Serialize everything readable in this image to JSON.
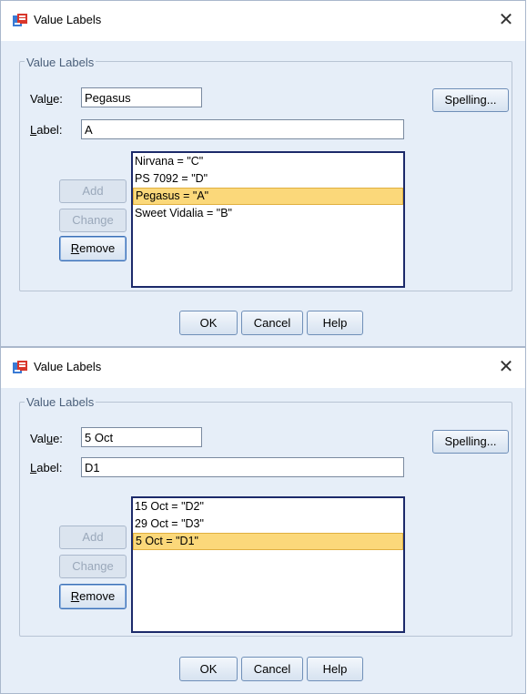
{
  "dialogs": [
    {
      "title": "Value Labels",
      "group_label": "Value Labels",
      "value_label_prefix": "Val",
      "value_label_u": "u",
      "value_label_suffix": "e:",
      "value_input": "Pegasus",
      "label_label_u": "L",
      "label_label_rest": "abel:",
      "label_input": "A",
      "spelling_button": "Spelling...",
      "add_button": "Add",
      "change_button": "Change",
      "remove_u": "R",
      "remove_rest": "emove",
      "list": [
        "Nirvana = \"C\"",
        "PS 7092 = \"D\"",
        "Pegasus = \"A\"",
        "Sweet Vidalia = \"B\""
      ],
      "selected_index": 2,
      "ok_button": "OK",
      "cancel_button": "Cancel",
      "help_button": "Help"
    },
    {
      "title": "Value Labels",
      "group_label": "Value Labels",
      "value_label_prefix": "Val",
      "value_label_u": "u",
      "value_label_suffix": "e:",
      "value_input": "5 Oct",
      "label_label_u": "L",
      "label_label_rest": "abel:",
      "label_input": "D1",
      "spelling_button": "Spelling...",
      "add_button": "Add",
      "change_button": "Change",
      "remove_u": "R",
      "remove_rest": "emove",
      "list": [
        "15 Oct = \"D2\"",
        "29 Oct = \"D3\"",
        "5 Oct = \"D1\""
      ],
      "selected_index": 2,
      "ok_button": "OK",
      "cancel_button": "Cancel",
      "help_button": "Help"
    }
  ],
  "colors": {
    "dialog_bg": "#e6eef8",
    "selection": "#fbd87a",
    "listbox_border": "#1c2a6a"
  },
  "icons": {
    "app": "spss-value-labels-icon",
    "close": "close-icon"
  }
}
